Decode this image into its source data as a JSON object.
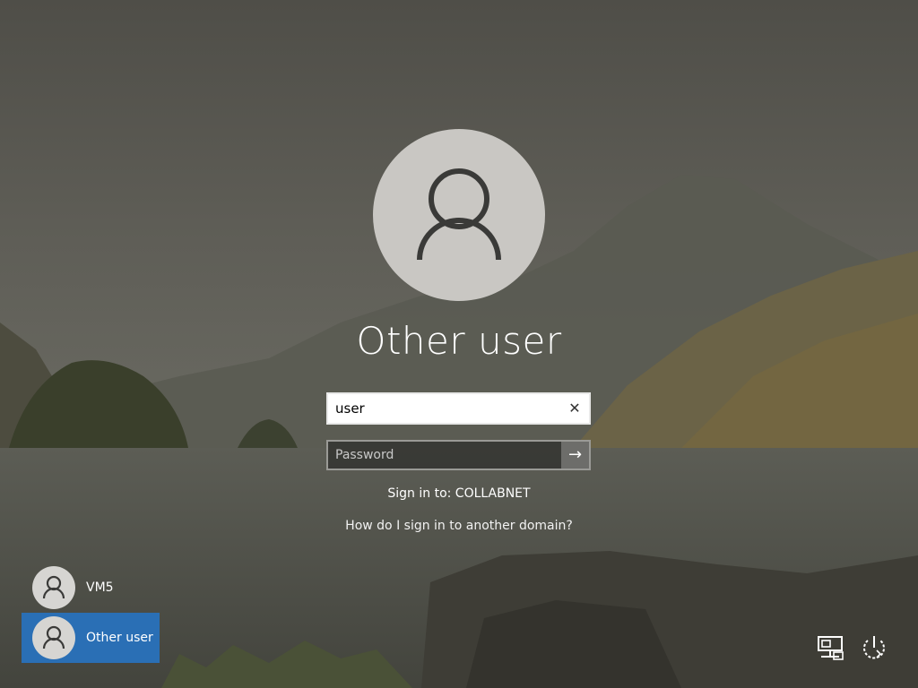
{
  "login": {
    "display_name": "Other user",
    "username_value": "user",
    "password_placeholder": "Password",
    "sign_in_to": "Sign in to: COLLABNET",
    "help_link": "How do I sign in to another domain?",
    "clear_icon": "close-icon",
    "submit_icon": "arrow-right-icon"
  },
  "users": [
    {
      "label": "VM5",
      "selected": false
    },
    {
      "label": "Other user",
      "selected": true
    }
  ],
  "system_icons": [
    "network-icon",
    "power-icon"
  ],
  "colors": {
    "selected_tile": "#2a6fb5",
    "avatar_bg": "#c9c7c3"
  }
}
